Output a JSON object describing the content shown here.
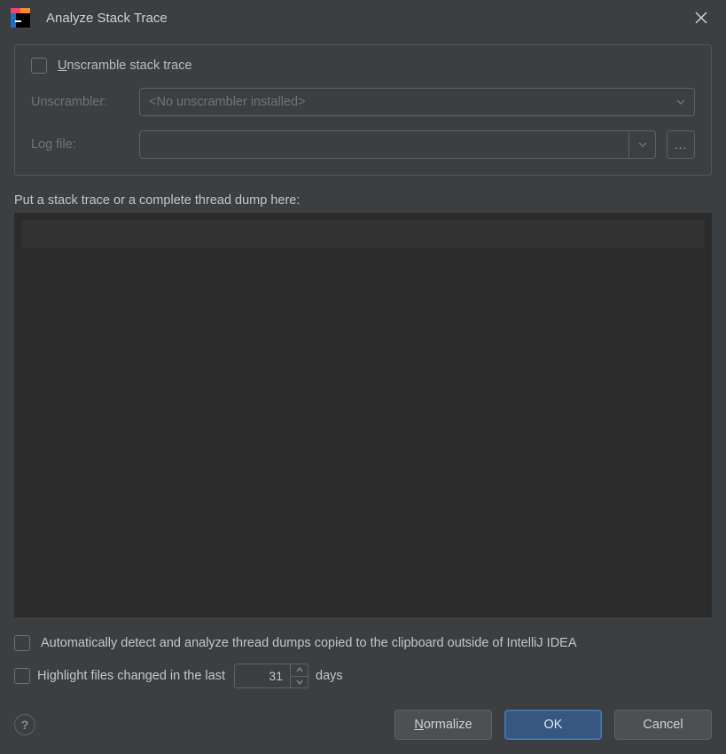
{
  "titlebar": {
    "title": "Analyze Stack Trace"
  },
  "panel": {
    "unscramble_label_pre": "U",
    "unscramble_label_rest": "nscramble stack trace",
    "unscrambler_label": "Unscrambler:",
    "unscrambler_value": "<No unscrambler installed>",
    "logfile_label": "Log file:",
    "logfile_value": "",
    "browse_glyph": "..."
  },
  "textarea": {
    "label": "Put a stack trace or a complete thread dump here:",
    "value": ""
  },
  "checks": {
    "auto_detect": "Automatically detect and analyze thread dumps copied to the clipboard outside of IntelliJ IDEA",
    "highlight_pre": "Highlight files changed in the last",
    "highlight_post": "days",
    "days_value": "31"
  },
  "footer": {
    "help_glyph": "?",
    "normalize_mn": "N",
    "normalize_rest": "ormalize",
    "ok": "OK",
    "cancel": "Cancel"
  }
}
